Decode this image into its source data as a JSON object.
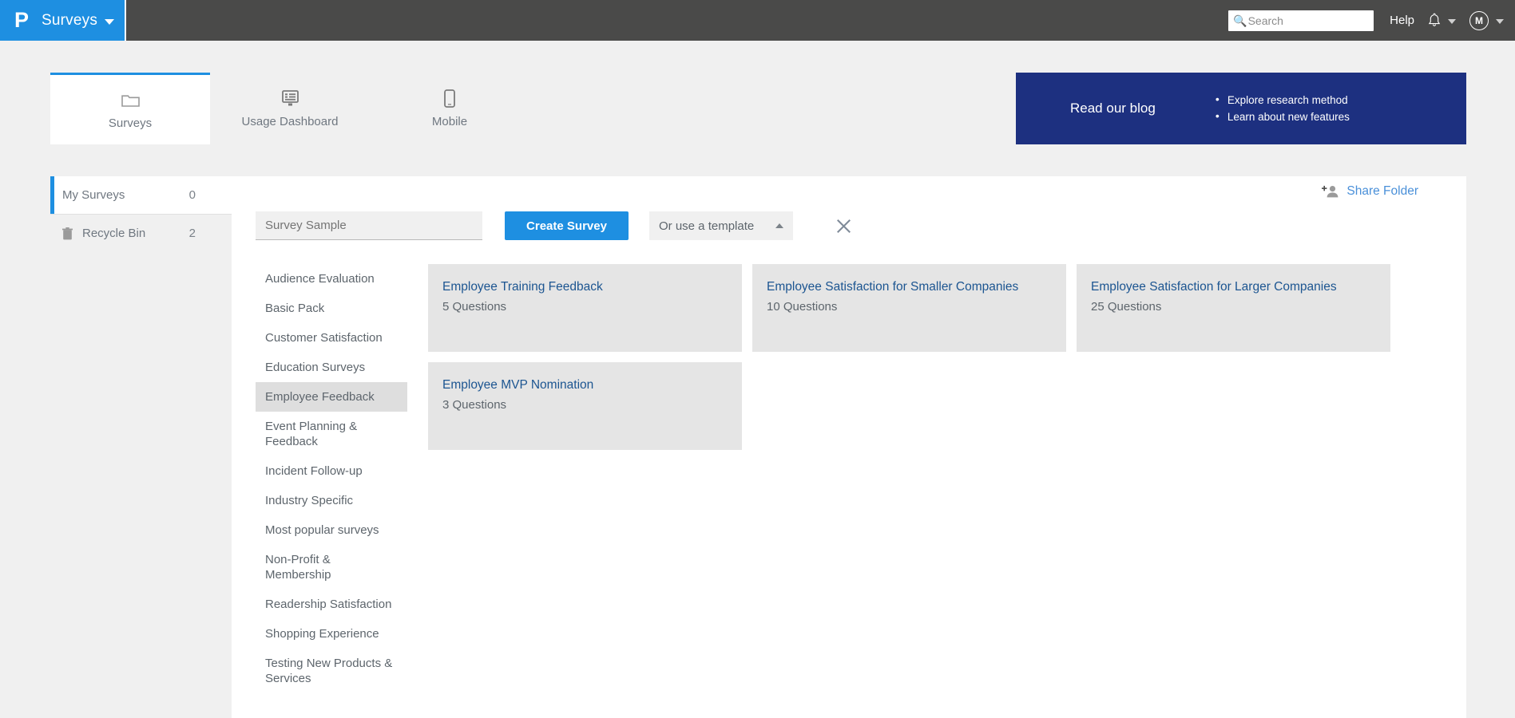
{
  "navbar": {
    "logo_glyph": "P",
    "brand_label": "Surveys",
    "search": {
      "placeholder": "Search",
      "value": "",
      "icon": "search-icon"
    },
    "help_label": "Help",
    "bell_icon": "bell-icon",
    "avatar_initial": "M"
  },
  "tabs": [
    {
      "label": "Surveys",
      "icon": "folder-icon",
      "active": true
    },
    {
      "label": "Usage Dashboard",
      "icon": "dashboard-icon",
      "active": false
    },
    {
      "label": "Mobile",
      "icon": "mobile-icon",
      "active": false
    }
  ],
  "banner": {
    "title": "Read our blog",
    "bullets": [
      "Explore research method",
      "Learn about new features"
    ],
    "background": "#1d3080"
  },
  "sidebar": {
    "items": [
      {
        "label": "My Surveys",
        "count": "0",
        "icon": "",
        "active": true
      },
      {
        "label": "Recycle Bin",
        "count": "2",
        "icon": "trash-icon",
        "active": false
      }
    ]
  },
  "content": {
    "share_folder_label": "Share Folder",
    "share_icon": "add-person-icon",
    "survey_name_value": "Survey Sample",
    "survey_name_placeholder": "Survey Sample",
    "create_button_label": "Create Survey",
    "template_select_label": "Or use a template",
    "close_icon": "close-icon"
  },
  "categories": [
    {
      "label": "Audience Evaluation",
      "selected": false
    },
    {
      "label": "Basic Pack",
      "selected": false
    },
    {
      "label": "Customer Satisfaction",
      "selected": false
    },
    {
      "label": "Education Surveys",
      "selected": false
    },
    {
      "label": "Employee Feedback",
      "selected": true
    },
    {
      "label": "Event Planning & Feedback",
      "selected": false
    },
    {
      "label": "Incident Follow-up",
      "selected": false
    },
    {
      "label": "Industry Specific",
      "selected": false
    },
    {
      "label": "Most popular surveys",
      "selected": false
    },
    {
      "label": "Non-Profit & Membership",
      "selected": false
    },
    {
      "label": "Readership Satisfaction",
      "selected": false
    },
    {
      "label": "Shopping Experience",
      "selected": false
    },
    {
      "label": "Testing New Products & Services",
      "selected": false
    }
  ],
  "templates": [
    {
      "title": "Employee Training Feedback",
      "questions": "5 Questions"
    },
    {
      "title": "Employee Satisfaction for Smaller Companies",
      "questions": "10 Questions"
    },
    {
      "title": "Employee Satisfaction for Larger Companies",
      "questions": "25 Questions"
    },
    {
      "title": "Employee MVP Nomination",
      "questions": "3 Questions"
    }
  ],
  "colors": {
    "brand_blue": "#1e8fe1",
    "navbar_grey": "#4a4a49",
    "banner_navy": "#1d3080",
    "link_blue": "#1c5591",
    "card_grey": "#e5e5e5"
  }
}
